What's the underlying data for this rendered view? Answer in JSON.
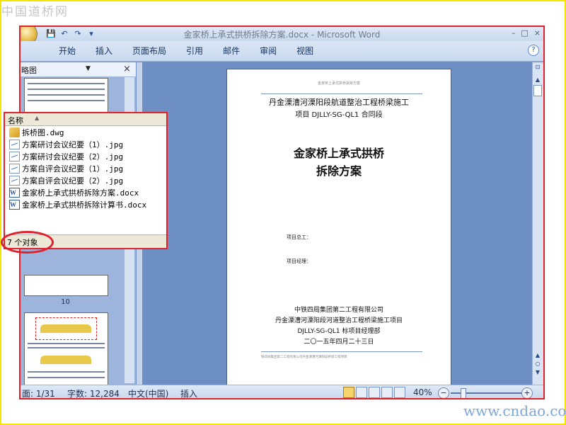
{
  "watermarks": {
    "top": "中国道桥网",
    "bottom": "www.cndao.com"
  },
  "window": {
    "title": "金家桥上承式拱桥拆除方案.docx - Microsoft Word",
    "quick_access": [
      {
        "name": "save-icon",
        "glyph": "💾"
      },
      {
        "name": "undo-icon",
        "glyph": "↶"
      },
      {
        "name": "redo-icon",
        "glyph": "↷"
      },
      {
        "name": "customize-qat-icon",
        "glyph": "▾"
      }
    ],
    "controls": [
      "–",
      "□",
      "×"
    ]
  },
  "ribbon": {
    "tabs": [
      "开始",
      "插入",
      "页面布局",
      "引用",
      "邮件",
      "审阅",
      "视图"
    ],
    "help": "?"
  },
  "nav_pane": {
    "title": "略图",
    "close": "×",
    "thumbnail_page_number": "10"
  },
  "document": {
    "header": "金家桥上承式拱桥拆除方案",
    "project_line1": "丹金溧漕河溧阳段航道整治工程桥梁施工",
    "project_line2": "项目 DJLLY-SG-QL1 合同段",
    "main_title_1": "金家桥上承式拱桥",
    "main_title_2": "拆除方案",
    "manager_label": "项目总工：",
    "manager2_label": "项目经理：",
    "company": "中铁四局集团第二工程有限公司",
    "project_dept": "丹金溧漕河溧阳段河道整治工程桥梁施工项目",
    "contract_dept": "DJLLY-SG-QL1 标项目经理部",
    "date": "二〇一五年四月二十三日",
    "footer": "铁四局集团第二工程有限公司丹金溧漕河溧阳段桥梁工程项目"
  },
  "file_popup": {
    "column_header": "名称",
    "files": [
      {
        "name": "拆桥图.dwg",
        "icon": "dwg-file-icon"
      },
      {
        "name": "方案研讨会议纪要（1）.jpg",
        "icon": "jpg-file-icon"
      },
      {
        "name": "方案研讨会议纪要（2）.jpg",
        "icon": "jpg-file-icon"
      },
      {
        "name": "方案自评会议纪要（1）.jpg",
        "icon": "jpg-file-icon"
      },
      {
        "name": "方案自评会议纪要（2）.jpg",
        "icon": "jpg-file-icon"
      },
      {
        "name": "金家桥上承式拱桥拆除方案.docx",
        "icon": "word-file-icon"
      },
      {
        "name": "金家桥上承式拱桥拆除计算书.docx",
        "icon": "word-file-icon"
      }
    ],
    "status": "7 个对象"
  },
  "status_bar": {
    "page": "面: 1/31",
    "words": "字数: 12,284",
    "language": "中文(中国)",
    "mode": "插入",
    "zoom": "40%"
  },
  "colors": {
    "accent_red": "#e0202a",
    "doc_bg": "#6d8fc3",
    "watermark_blue": "#7ea6d8"
  }
}
